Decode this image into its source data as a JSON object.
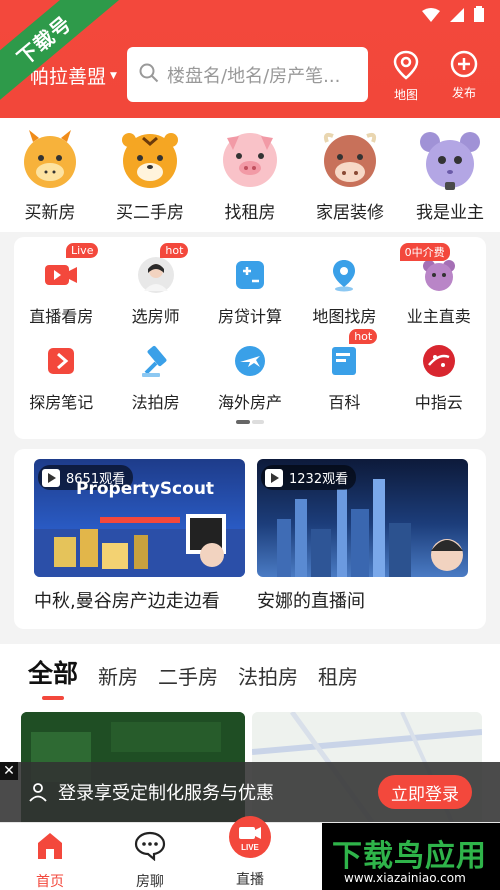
{
  "header": {
    "city": "帕拉善盟",
    "search_placeholder": "楼盘名/地名/房产笔...",
    "map_label": "地图",
    "publish_label": "发布",
    "ribbon_text": "下载号"
  },
  "categories": [
    {
      "label": "买新房",
      "icon": "dragon-icon"
    },
    {
      "label": "买二手房",
      "icon": "tiger-icon"
    },
    {
      "label": "找租房",
      "icon": "pig-icon"
    },
    {
      "label": "家居装修",
      "icon": "cow-icon"
    },
    {
      "label": "我是业主",
      "icon": "mouse-icon"
    }
  ],
  "services": [
    {
      "label": "直播看房",
      "badge": "Live",
      "icon": "live-video-icon"
    },
    {
      "label": "选房师",
      "badge": "hot",
      "icon": "agent-avatar"
    },
    {
      "label": "房贷计算",
      "badge": "",
      "icon": "calculator-icon"
    },
    {
      "label": "地图找房",
      "badge": "",
      "icon": "map-pin-icon"
    },
    {
      "label": "业主直卖",
      "badge": "0中介费",
      "icon": "mouse-mascot-icon"
    },
    {
      "label": "探房笔记",
      "badge": "",
      "icon": "play-note-icon"
    },
    {
      "label": "法拍房",
      "badge": "",
      "icon": "gavel-icon"
    },
    {
      "label": "海外房产",
      "badge": "",
      "icon": "plane-icon"
    },
    {
      "label": "百科",
      "badge": "hot",
      "icon": "book-icon"
    },
    {
      "label": "中指云",
      "badge": "",
      "icon": "zhongzhi-logo"
    }
  ],
  "live": [
    {
      "views": "8651观看",
      "title": "中秋,曼谷房产边走边看",
      "brand": "PropertyScout"
    },
    {
      "views": "1232观看",
      "title": "安娜的直播间"
    }
  ],
  "tabs": [
    "全部",
    "新房",
    "二手房",
    "法拍房",
    "租房"
  ],
  "login_banner": {
    "text": "登录享受定制化服务与优惠",
    "button": "立即登录"
  },
  "bottom_nav": [
    {
      "label": "首页",
      "icon": "home-icon"
    },
    {
      "label": "房聊",
      "icon": "chat-icon"
    },
    {
      "label": "直播",
      "icon": "live-icon"
    }
  ],
  "brand": {
    "main": "下载鸟应用",
    "url": "www.xiazainiao.com"
  },
  "colors": {
    "accent": "#f3483c",
    "brand_green": "#2fb44a"
  }
}
